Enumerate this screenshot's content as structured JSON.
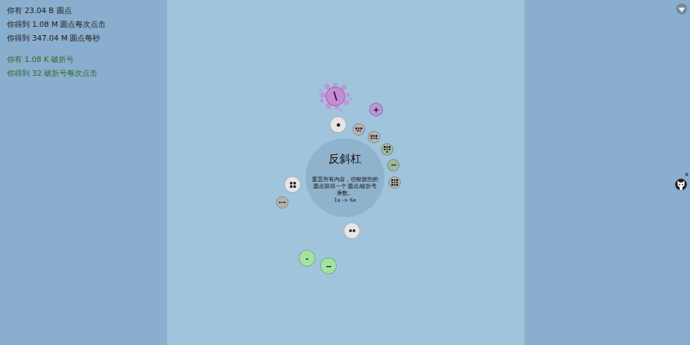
{
  "stats": [
    {
      "text": "你有 23.04 B 圆点",
      "color": "#1e1e1e"
    },
    {
      "text": "你得到 1.08 M 圆点每次点击",
      "color": "#1e1e1e"
    },
    {
      "text": "你得到 347.04 M 圆点每秒",
      "color": "#1e1e1e"
    },
    {
      "text": "你有 1.08 K 破折号",
      "color": "#2e6b2e"
    },
    {
      "text": "你得到 32 破折号每次点击",
      "color": "#2e6b2e"
    }
  ],
  "center": {
    "title": "反斜杠",
    "description": "重置所有内容，但根据您的圆点获得一个 圆点/破折号 乘数。",
    "multiplier": "1x -> 6x"
  },
  "nodes": [
    {
      "kind": "splat",
      "label": "\\",
      "color": "#c98ad6"
    },
    {
      "kind": "symbol",
      "label": "+",
      "color": "#b995d9"
    },
    {
      "kind": "dots",
      "dots": 1,
      "color": "#e6e6e6"
    },
    {
      "kind": "dots",
      "dots": 5,
      "color": "#b3b3b3"
    },
    {
      "kind": "dots",
      "dots": 6,
      "color": "#b3b3b3"
    },
    {
      "kind": "dots",
      "dots": 7,
      "color": "#9fb99c"
    },
    {
      "kind": "symbol",
      "label": "---",
      "color": "#9fb99c"
    },
    {
      "kind": "dots",
      "dots": 9,
      "color": "#b3b3b3"
    },
    {
      "kind": "dots",
      "dots": 4,
      "color": "#e6e6e6"
    },
    {
      "kind": "dots",
      "dots": 3,
      "color": "#b3b3b3"
    },
    {
      "kind": "dots",
      "dots": 2,
      "color": "#e6e6e6"
    },
    {
      "kind": "symbol",
      "label": "-",
      "color": "#a3e3a0"
    },
    {
      "kind": "symbol",
      "label": "--",
      "color": "#a3e3a0"
    }
  ],
  "corner": {
    "close": "x"
  }
}
